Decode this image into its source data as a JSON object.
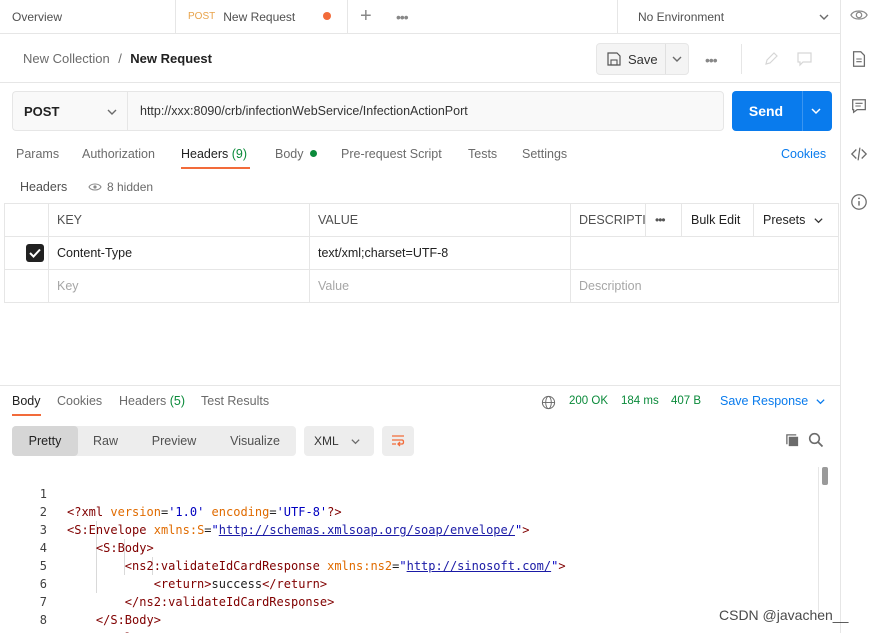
{
  "tabs": {
    "overview": "Overview",
    "active_method": "POST",
    "active_title": "New Request",
    "environment": "No Environment"
  },
  "breadcrumb": {
    "collection": "New Collection",
    "separator": "/",
    "request": "New Request"
  },
  "toolbar": {
    "save_label": "Save"
  },
  "request": {
    "method": "POST",
    "url": "http://xxx:8090/crb/infectionWebService/InfectionActionPort",
    "send_label": "Send"
  },
  "request_tabs": {
    "params": "Params",
    "authorization": "Authorization",
    "headers": "Headers",
    "headers_count": "(9)",
    "body": "Body",
    "pre_request": "Pre-request Script",
    "tests": "Tests",
    "settings": "Settings",
    "cookies": "Cookies"
  },
  "headers_section": {
    "title": "Headers",
    "hidden": "8 hidden",
    "col_key": "KEY",
    "col_value": "VALUE",
    "col_description": "DESCRIPTI",
    "bulk_edit": "Bulk Edit",
    "presets": "Presets",
    "rows": [
      {
        "checked": true,
        "key": "Content-Type",
        "value": "text/xml;charset=UTF-8",
        "description": ""
      }
    ],
    "placeholder_key": "Key",
    "placeholder_value": "Value",
    "placeholder_description": "Description"
  },
  "response": {
    "tabs": {
      "body": "Body",
      "cookies": "Cookies",
      "headers": "Headers",
      "headers_count": "(5)",
      "test_results": "Test Results"
    },
    "status": "200 OK",
    "time": "184 ms",
    "size": "407 B",
    "save_response": "Save Response",
    "view_modes": [
      "Pretty",
      "Raw",
      "Preview",
      "Visualize"
    ],
    "active_view": "Pretty",
    "format": "XML",
    "code": [
      {
        "n": "1",
        "text": "<?xml version='1.0' encoding='UTF-8'?>"
      },
      {
        "n": "2",
        "text": "<S:Envelope xmlns:S=\"http://schemas.xmlsoap.org/soap/envelope/\">"
      },
      {
        "n": "3",
        "text": "    <S:Body>"
      },
      {
        "n": "4",
        "text": "        <ns2:validateIdCardResponse xmlns:ns2=\"http://sinosoft.com/\">"
      },
      {
        "n": "5",
        "text": "            <return>success</return>"
      },
      {
        "n": "6",
        "text": "        </ns2:validateIdCardResponse>"
      },
      {
        "n": "7",
        "text": "    </S:Body>"
      },
      {
        "n": "8",
        "text": "</S:Envelope>"
      }
    ]
  },
  "watermark": "CSDN @javachen__",
  "colors": {
    "accent": "#f26b3a",
    "send": "#097bed",
    "status_ok": "#0a8a3a",
    "link": "#097bed"
  },
  "icons": {
    "eye": "eye-icon",
    "doc": "document-icon",
    "comment": "comment-icon",
    "code": "code-icon",
    "info": "info-icon",
    "globe": "globe-icon",
    "copy": "copy-icon",
    "search": "search-icon",
    "wrap": "wrap-icon"
  }
}
